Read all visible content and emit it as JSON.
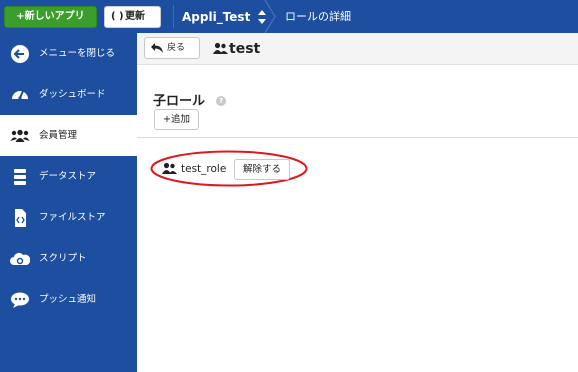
{
  "topbar": {
    "new_app_label": "+新しいアプリ",
    "refresh_label": "更新",
    "app_name": "Appli_Test",
    "page_title": "ロールの詳細"
  },
  "sidebar": {
    "items": [
      {
        "label": "メニューを閉じる",
        "icon": "arrow-left-circle-icon",
        "active": false
      },
      {
        "label": "ダッシュボード",
        "icon": "gauge-icon",
        "active": false
      },
      {
        "label": "会員管理",
        "icon": "users-icon",
        "active": true
      },
      {
        "label": "データストア",
        "icon": "database-icon",
        "active": false
      },
      {
        "label": "ファイルストア",
        "icon": "file-code-icon",
        "active": false
      },
      {
        "label": "スクリプト",
        "icon": "cloud-gear-icon",
        "active": false
      },
      {
        "label": "プッシュ通知",
        "icon": "chat-bubble-icon",
        "active": false
      }
    ]
  },
  "main": {
    "back_label": "戻る",
    "role_name": "test",
    "section_title": "子ロール",
    "help_label": "?",
    "add_label": "+追加",
    "children": [
      {
        "name": "test_role",
        "unset_label": "解除する"
      }
    ]
  },
  "colors": {
    "nav_bg": "#1d4ea0",
    "new_app_green": "#3a9d2c",
    "highlight_red": "#e0171b"
  }
}
